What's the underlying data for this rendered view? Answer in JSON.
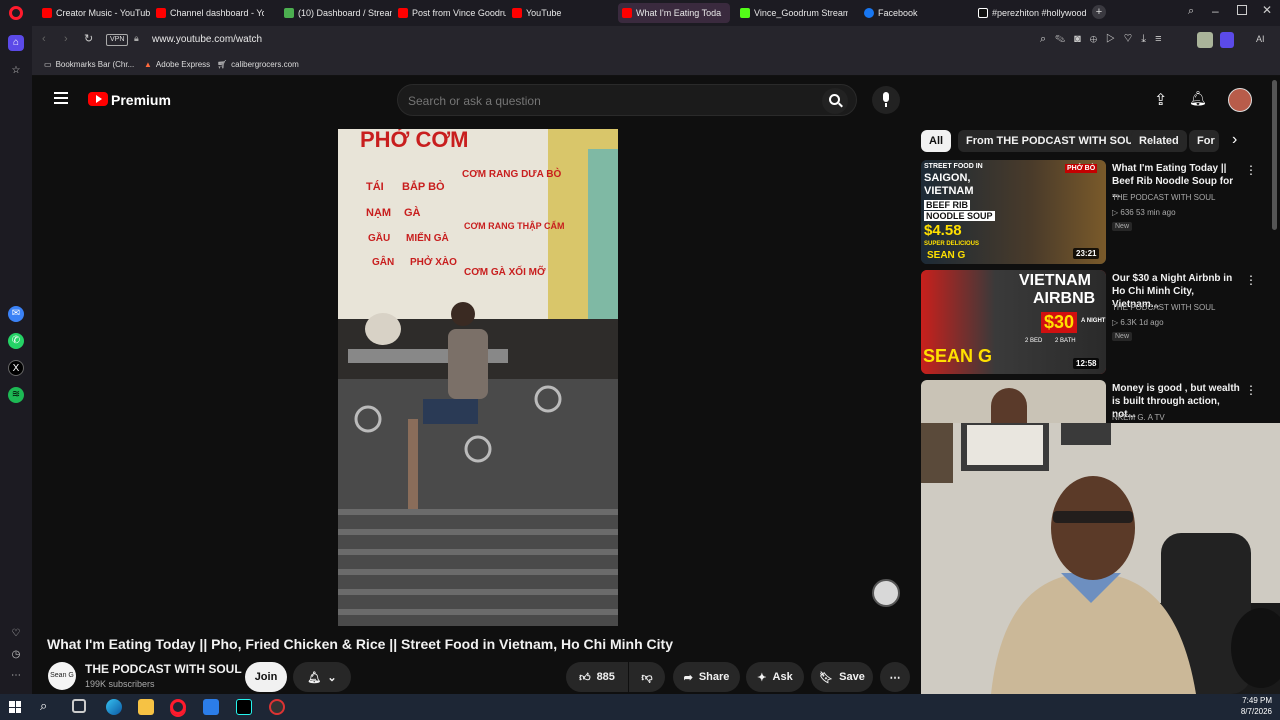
{
  "browser": {
    "tabs": [
      {
        "label": "Creator Music - YouTube",
        "color": "#ff0000"
      },
      {
        "label": "Channel dashboard - You",
        "color": "#ff0000"
      },
      {
        "label": "(10) Dashboard / Streamla",
        "color": "#4caf50"
      },
      {
        "label": "Post from Vince Goodrum",
        "color": "#ff0000"
      },
      {
        "label": "YouTube",
        "color": "#ff0000"
      },
      {
        "label": "What I'm Eating Toda",
        "color": "#ff0000"
      },
      {
        "label": "Vince_Goodrum Stream -",
        "color": "#53fc18"
      },
      {
        "label": "Facebook",
        "color": "#1877f2"
      },
      {
        "label": "#perezhiton #hollywood",
        "color": "#ffffff"
      }
    ],
    "url": "www.youtube.com/watch",
    "vpn_label": "VPN",
    "bookmarks": [
      "Bookmarks Bar (Chr...",
      "Adobe Express",
      "calibergrocers.com"
    ],
    "ai_label": "AI"
  },
  "youtube": {
    "logo_text": "Premium",
    "search_placeholder": "Search or ask a question",
    "video_title": "What I'm Eating Today || Pho, Fried Chicken & Rice || Street Food in Vietnam, Ho Chi Minh City",
    "channel_name": "THE PODCAST WITH SOUL",
    "subscribers": "199K subscribers",
    "avatar_text": "Sean G",
    "join_label": "Join",
    "like_count": "885",
    "share_label": "Share",
    "ask_label": "Ask",
    "save_label": "Save",
    "chips": [
      "All",
      "From THE PODCAST WITH SOUL",
      "Related",
      "For"
    ],
    "recommendations": [
      {
        "title": "What I'm Eating Today || Beef Rib Noodle Soup for ...",
        "channel": "THE PODCAST WITH SOUL",
        "meta": "▷ 636  53 min ago",
        "badge": "New",
        "duration": "23:21",
        "thumb_text": [
          "STREET FOOD IN",
          "SAIGON,",
          "VIETNAM",
          "BEEF RIB",
          "NOODLE SOUP",
          "$4.58",
          "SUPER DELICIOUS",
          "SEAN G",
          "PHỞ BÒ"
        ]
      },
      {
        "title": "Our $30 a Night Airbnb in Ho Chi Minh City, Vietnam...",
        "channel": "THE PODCAST WITH SOUL",
        "meta": "▷ 6.3K  1d ago",
        "badge": "New",
        "duration": "12:58",
        "thumb_text": [
          "VIETNAM",
          "AIRBNB",
          "$30",
          "A NIGHT",
          "SEAN G",
          "2 BED",
          "2 BATH"
        ]
      },
      {
        "title": "Money is good , but wealth is built through action, not...",
        "channel": "NKEM G. A TV"
      }
    ],
    "video_sign_text": [
      "PHỞ CƠM",
      "TÁI",
      "BẮP BÒ",
      "NẠM",
      "GÀ",
      "GẦU",
      "MIẾN GÀ",
      "GÂN",
      "PHỞ XÀO",
      "CƠM RANG DƯA BÒ",
      "CƠM RANG THẬP CẨM",
      "CƠM GÀ XỐI MỠ"
    ]
  },
  "taskbar": {
    "time": "7:49 PM",
    "date": "8/7/2026"
  },
  "colors": {
    "yt_red": "#ff0000",
    "bg": "#0f0f0f",
    "chip_active": "#f1f1f1"
  }
}
